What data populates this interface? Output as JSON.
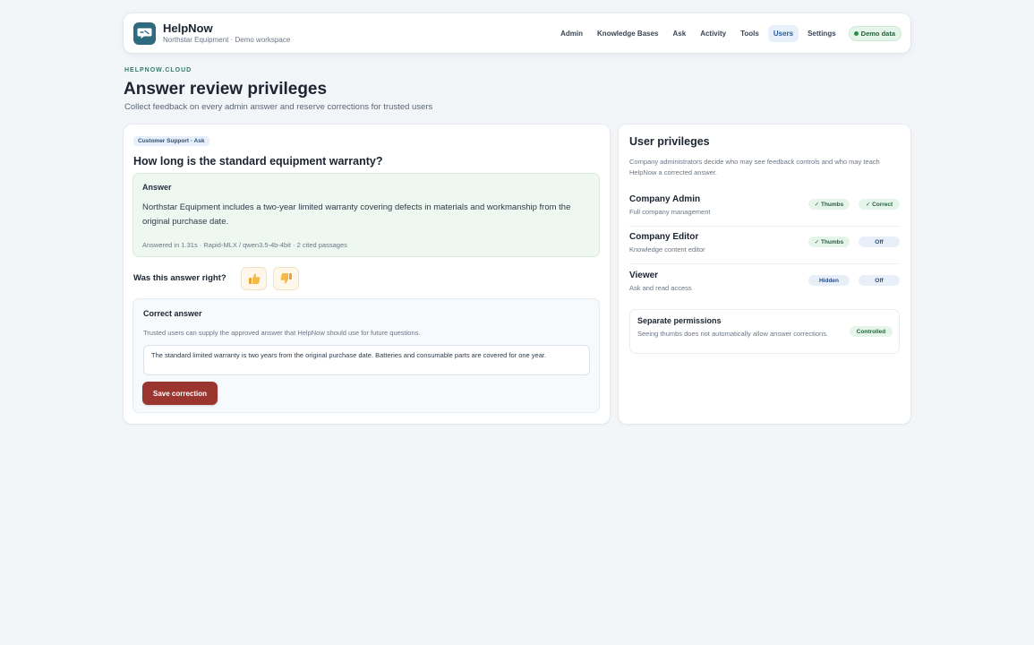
{
  "header": {
    "app_name": "HelpNow",
    "workspace": "Northstar Equipment · Demo workspace",
    "nav": [
      "Admin",
      "Knowledge Bases",
      "Ask",
      "Activity",
      "Tools",
      "Users",
      "Settings"
    ],
    "active_nav": "Users",
    "demo_label": "Demo data"
  },
  "page": {
    "eyebrow": "HELPNOW.CLOUD",
    "title": "Answer review privileges",
    "subtitle": "Collect feedback on every admin answer and reserve corrections for trusted users"
  },
  "answer_card": {
    "tag": "Customer Support · Ask",
    "question": "How long is the standard equipment warranty?",
    "answer_label": "Answer",
    "answer_text": "Northstar Equipment includes a two-year limited warranty covering defects in materials and workmanship from the original purchase date.",
    "answer_meta": "Answered in 1.31s · Rapid-MLX / qwen3.5-4b-4bit · 2 cited passages",
    "feedback_question": "Was this answer right?",
    "thumb_up_icon": "thumbs-up-icon",
    "thumb_down_icon": "thumbs-down-icon",
    "correction": {
      "title": "Correct answer",
      "help": "Trusted users can supply the approved answer that HelpNow should use for future questions.",
      "value": "The standard limited warranty is two years from the original purchase date. Batteries and consumable parts are covered for one year.",
      "save_label": "Save correction"
    }
  },
  "privileges": {
    "title": "User privileges",
    "description": "Company administrators decide who may see feedback controls and who may teach HelpNow a corrected answer.",
    "roles": [
      {
        "name": "Company Admin",
        "sub": "Full company management",
        "feedback": "✓ Thumbs",
        "correction": "✓ Correct",
        "feedback_color": "green",
        "correction_color": "green"
      },
      {
        "name": "Company Editor",
        "sub": "Knowledge content editor",
        "feedback": "✓ Thumbs",
        "correction": "Off",
        "feedback_color": "green",
        "correction_color": "blue"
      },
      {
        "name": "Viewer",
        "sub": "Ask and read access",
        "feedback": "Hidden",
        "correction": "Off",
        "feedback_color": "blue",
        "correction_color": "blue"
      }
    ],
    "separate": {
      "title": "Separate permissions",
      "description": "Seeing thumbs does not automatically allow answer corrections.",
      "badge": "Controlled"
    }
  },
  "colors": {
    "accent_red": "#9b3530",
    "brand_teal": "#2f6b7e",
    "success_green": "#25613d",
    "info_blue": "#2b4f80"
  }
}
